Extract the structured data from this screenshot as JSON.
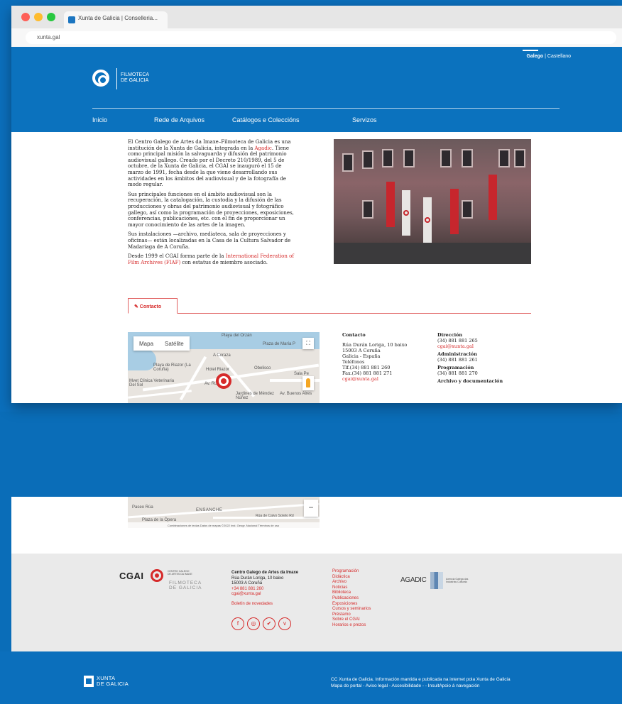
{
  "browser": {
    "tab_title": "Xunta de Galicia | Conselleria...",
    "url": "xunta.gal"
  },
  "header": {
    "lang_active": "Galego",
    "lang_sep": " | ",
    "lang_other": "Castellano",
    "logo_line1": "FILMOTECA",
    "logo_line2": "DE GALICIA",
    "nav": [
      "Inicio",
      "Rede de Arquivos",
      "Catálogos e Coleccións",
      "Servizos"
    ]
  },
  "intro": {
    "p1_a": "El Centro Galego de Artes da Imaxe–Filmoteca de Galicia es una institución de la Xunta de Galicia, integrada en la ",
    "p1_link": "Agadic",
    "p1_b": ". Tiene como principal misión la salvaguarda y difusión del patrimonio audiovisual gallego. Creado por el Decreto 210/1989, del 5 de octubre, de la Xunta de Galicia, el CGAI se inauguró el 15 de marzo de 1991, fecha desde la que viene desarrollando sus actividades en los ámbitos del audiovisual y de la fotografía de modo regular.",
    "p2": "Sus principales funciones en el ámbito audiovisual son la recuperación, la catalogación, la custodia y la difusión de las producciones y obras del patrimonio audiovisual y fotográfico gallego, así como la programación de proyecciones, exposiciones, conferencias, publicaciones, etc. con el fin de proporcionar un mayor conocimiento de las artes de la imagen.",
    "p3": "Sus instalaciones —archivo, mediateca, sala de proyecciones y oficinas— están localizadas en la Casa de la Cultura Salvador de Madariaga de A Coruña.",
    "p4_a": "Desde 1999 el CGAI forma parte de la ",
    "p4_link": "International Federation of Film Archives (FIAF)",
    "p4_b": " con estatus de miembro asociado."
  },
  "contact_tab": "✎ Contacto",
  "map": {
    "btn_map": "Mapa",
    "btn_sat": "Satélite",
    "labels": [
      "Playa del Orzán",
      "Plaza de María P",
      "A Coraza",
      "Playa de Riazor (La Coruña)",
      "Hotel Riazor",
      "Obelisco",
      "Sala Pe",
      "Mvet Clinica Veterinaria Del Sol",
      "Av. Rubine",
      "Jardines de Méndez Núñez",
      "Av. Buenos Aires"
    ],
    "labels2": [
      "Paseo Rúa",
      "ENSANCHE",
      "Plaza de la Ópera",
      "Rúa de Calvo Sotelo Rd"
    ],
    "attrib": "Combinaciones de teclas   Datos de mapas ©2022 Inst. Geogr. Nacional   Términos de uso"
  },
  "contact": {
    "title": "Contacto",
    "address": [
      "Rúa Durán Loriga, 10 baixo",
      "15003 A Coruña",
      "Galicia - España"
    ],
    "phones_title": "Teléfonos",
    "tel": "Tlf.(34) 881 881 260",
    "fax": "Fax.(34) 881 881 271",
    "email": "cgai@xunta.gal"
  },
  "departments": {
    "direccion_title": "Dirección",
    "direccion_tel": "(34) 881 881 265",
    "direccion_email": "cgai@xunta.gal",
    "admin_title": "Administración",
    "admin_tel": "(34) 881 881 261",
    "prog_title": "Programación",
    "prog_tel": "(34) 881 881 270",
    "archivo_title": "Archivo y documentación"
  },
  "footer": {
    "cgai_big": "CGAI",
    "cgai_small": [
      "CENTRO GALEGO",
      "DE ARTES DA IMAXE"
    ],
    "cgai_film": [
      "FILMOTECA",
      "DE GALICIA"
    ],
    "centre_name": "Centro Galego de Artes da Imaxe",
    "centre_address": [
      "Rúa Durán Loriga, 10 baixo",
      "15003 A Coruña"
    ],
    "centre_phone": "+34 881 881 260",
    "centre_email": "cgai@xunta.gal",
    "newsletter": "Boletín de novedades",
    "social_icons": [
      "facebook-icon",
      "instagram-icon",
      "twitter-icon",
      "vimeo-icon"
    ],
    "links": [
      "Programación",
      "Didáctica",
      "Archivo",
      "Noticias",
      "Biblioteca",
      "Publicaciones",
      "Exposiciones",
      "Cursos y seminarios",
      "Préstamo",
      "Sobre el CGAI",
      "Horarios e prezos"
    ],
    "agadic": "AGADIC",
    "agadic_small": [
      "Axencia Galega das",
      "Industrias Culturais"
    ]
  },
  "bottom": {
    "xunta_line1": "XUNTA",
    "xunta_line2": "DE GALICIA",
    "legal1": "CC Xunta de Galicia. Información mantida e publicada na internet pola Xunta de Galicia",
    "legal2": "Mapa do portal - Aviso legal - Accesibilidade -  - InsuitApoio á navegación"
  },
  "colors": {
    "brand_blue": "#0b72be",
    "accent_red": "#d62a2a"
  }
}
